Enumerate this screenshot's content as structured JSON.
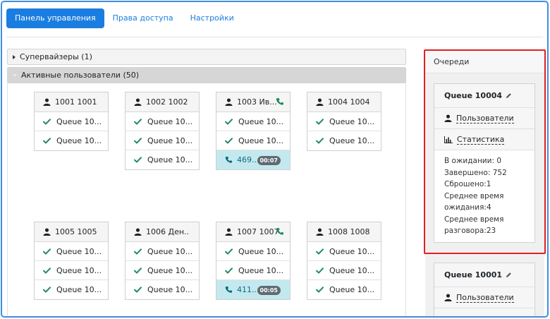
{
  "tabs": [
    {
      "label": "Панель управления",
      "active": true
    },
    {
      "label": "Права доступа",
      "active": false
    },
    {
      "label": "Настройки",
      "active": false
    }
  ],
  "sections": {
    "supervisors": {
      "label": "Супервайзеры (1)",
      "expanded": false
    },
    "active_users": {
      "label": "Активные пользователи (50)",
      "expanded": true
    }
  },
  "users": [
    {
      "name": "1001 1001",
      "queues": [
        "Queue 10...",
        "Queue 10..."
      ]
    },
    {
      "name": "1002 1002",
      "queues": [
        "Queue 10...",
        "Queue 10...",
        "Queue 10..."
      ]
    },
    {
      "name": "1003 Ив...",
      "on_call": true,
      "queues": [
        "Queue 10...",
        "Queue 10..."
      ],
      "call": {
        "number": "469...",
        "timer": "00:07"
      }
    },
    {
      "name": "1004 1004",
      "queues": [
        "Queue 10...",
        "Queue 10..."
      ]
    },
    {
      "name": "1005 1005",
      "queues": [
        "Queue 10...",
        "Queue 10...",
        "Queue 10..."
      ]
    },
    {
      "name": "1006 Ден...",
      "queues": [
        "Queue 10...",
        "Queue 10...",
        "Queue 10..."
      ]
    },
    {
      "name": "1007 1007",
      "on_call": true,
      "queues": [
        "Queue 10...",
        "Queue 10..."
      ],
      "call": {
        "number": "411...",
        "timer": "00:05"
      }
    },
    {
      "name": "1008 1008",
      "queues": [
        "Queue 10...",
        "Queue 10...",
        "Queue 10..."
      ]
    }
  ],
  "queues_panel": {
    "title": "Очереди",
    "queues": [
      {
        "name": "Queue 10004",
        "users_link": "Пользователи",
        "stats_link": "Статистика",
        "stats": [
          "В ожидании: 0",
          "Завершено: 752",
          "Сброшено:1",
          "Среднее время",
          "ожидания:4",
          "Среднее время",
          "разговора:23"
        ]
      },
      {
        "name": "Queue 10001",
        "users_link": "Пользователи"
      }
    ]
  },
  "colors": {
    "accent": "#1a7ee0",
    "check": "#1e8a5a",
    "call_bg": "#c3e9ef",
    "highlight": "#e32020"
  }
}
